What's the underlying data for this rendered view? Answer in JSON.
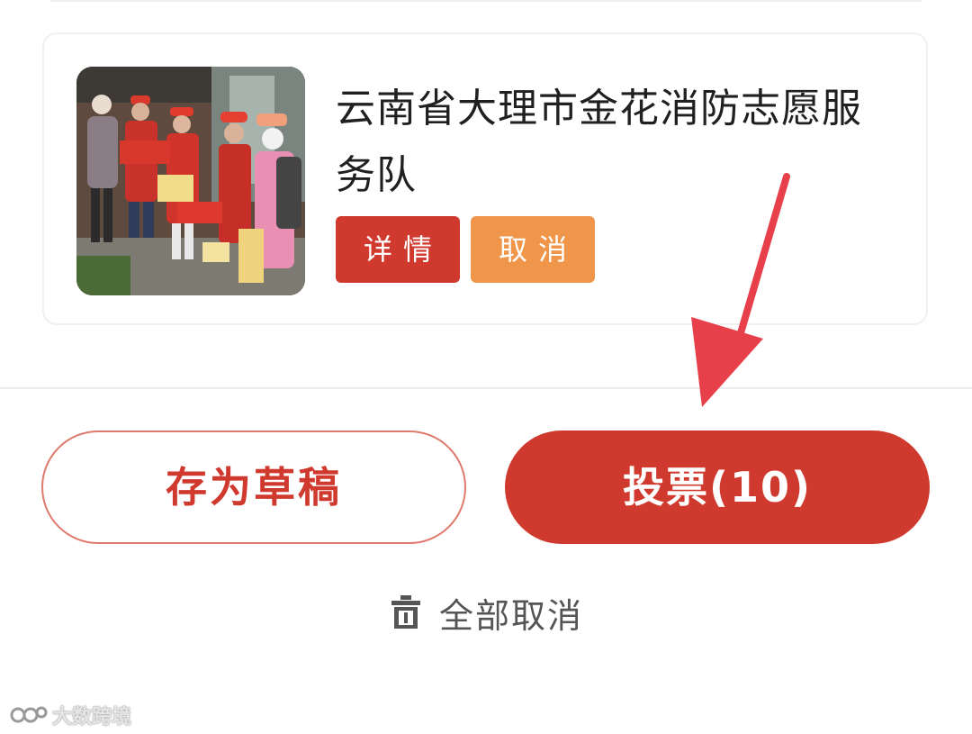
{
  "team_card": {
    "name": "云南省大理市金花消防志愿服务队",
    "detail_label": "详情",
    "cancel_label": "取消"
  },
  "actions": {
    "draft_label": "存为草稿",
    "vote_label": "投票(10)",
    "clear_all_label": "全部取消"
  },
  "watermark": {
    "text": "大数跨境"
  },
  "colors": {
    "primary_red": "#d03a2e",
    "cancel_orange": "#f0964a",
    "arrow_red": "#e8404a"
  }
}
